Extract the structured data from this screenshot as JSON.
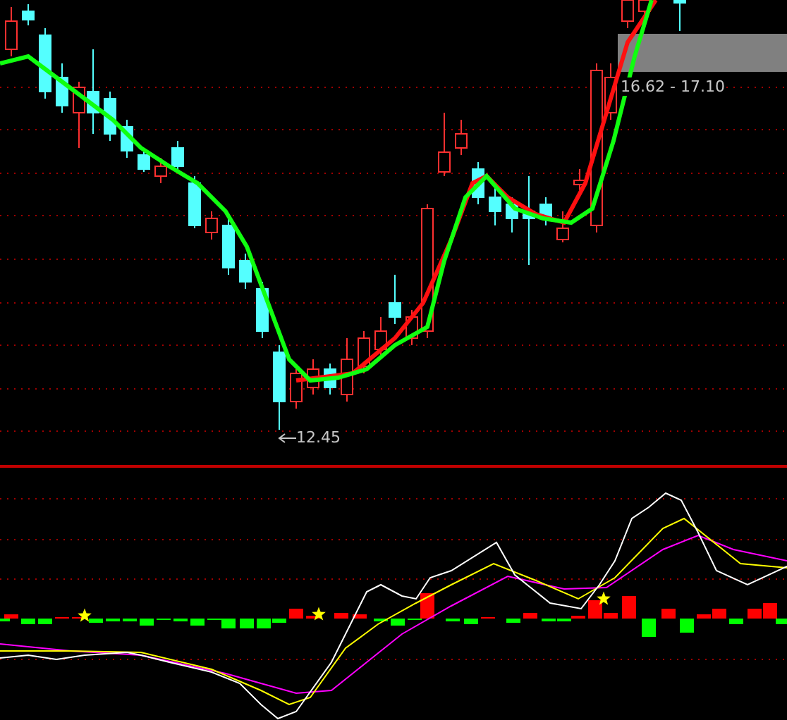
{
  "main_chart": {
    "low_marker": {
      "value": "12.45"
    },
    "range_label": {
      "text": "16.62 - 17.10"
    }
  },
  "indicator_chart": {
    "signal_stars": true
  }
}
